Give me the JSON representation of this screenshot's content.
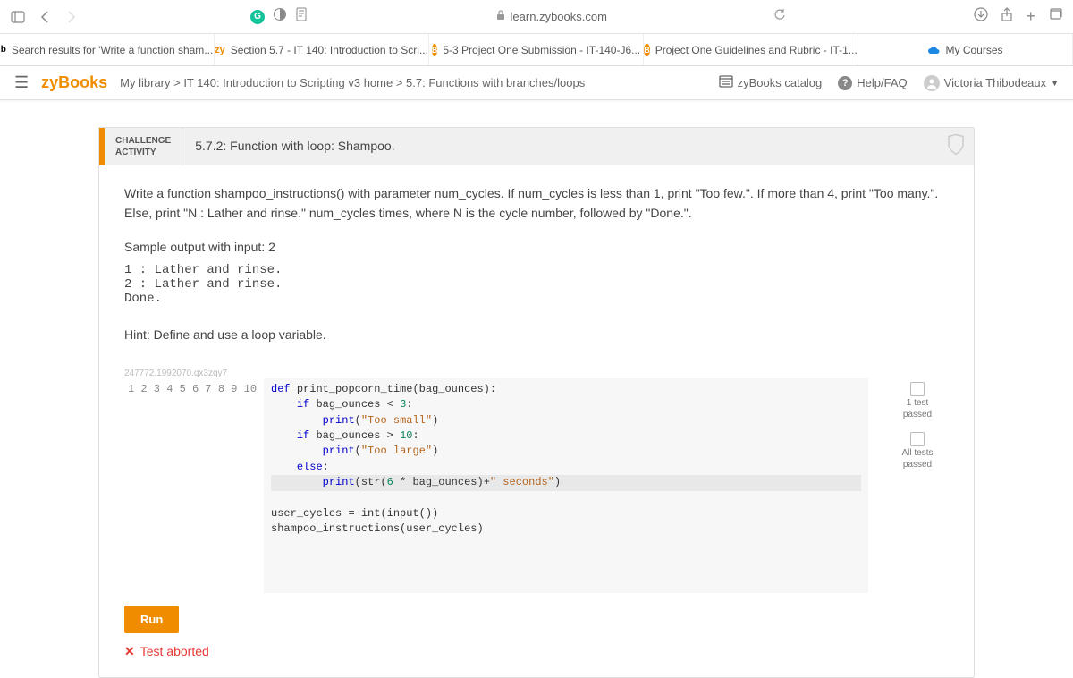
{
  "browser": {
    "url_host": "learn.zybooks.com",
    "tabs": [
      {
        "favicon": "b",
        "label": "Search results for 'Write a function sham..."
      },
      {
        "favicon": "zy",
        "label": "Section 5.7 - IT 140: Introduction to Scri..."
      },
      {
        "favicon": "B",
        "label": "5-3 Project One Submission - IT-140-J6..."
      },
      {
        "favicon": "B",
        "label": "Project One Guidelines and Rubric - IT-1..."
      },
      {
        "favicon": "cloud",
        "label": "My Courses"
      }
    ]
  },
  "zyheader": {
    "logo": "zyBooks",
    "breadcrumb": "My library > IT 140: Introduction to Scripting v3 home > 5.7: Functions with branches/loops",
    "catalog": "zyBooks catalog",
    "help": "Help/FAQ",
    "user": "Victoria Thibodeaux"
  },
  "activity": {
    "badge_line1": "CHALLENGE",
    "badge_line2": "ACTIVITY",
    "title": "5.7.2: Function with loop: Shampoo.",
    "instructions": "Write a function shampoo_instructions() with parameter num_cycles. If num_cycles is less than 1, print \"Too few.\". If more than 4, print \"Too many.\". Else, print \"N : Lather and rinse.\" num_cycles times, where N is the cycle number, followed by \"Done.\".",
    "sample_label": "Sample output with input: 2",
    "sample_output": "1 : Lather and rinse.\n2 : Lather and rinse.\nDone.",
    "hint": "Hint: Define and use a loop variable.",
    "code_id": "247772.1992070.qx3zqy7",
    "run_label": "Run",
    "aborted": "Test aborted",
    "tests": {
      "t1_line1": "1 test",
      "t1_line2": "passed",
      "t2_line1": "All tests",
      "t2_line2": "passed"
    },
    "code": {
      "line1": "def print_popcorn_time(bag_ounces):",
      "line2": "    if bag_ounces < 3:",
      "line3": "        print(\"Too small\")",
      "line4": "    if bag_ounces > 10:",
      "line5": "        print(\"Too large\")",
      "line6": "    else:",
      "line7": "        print(str(6 * bag_ounces)+\" seconds\")",
      "line8": "",
      "line9": "user_cycles = int(input())",
      "line10": "shampoo_instructions(user_cycles)"
    }
  }
}
